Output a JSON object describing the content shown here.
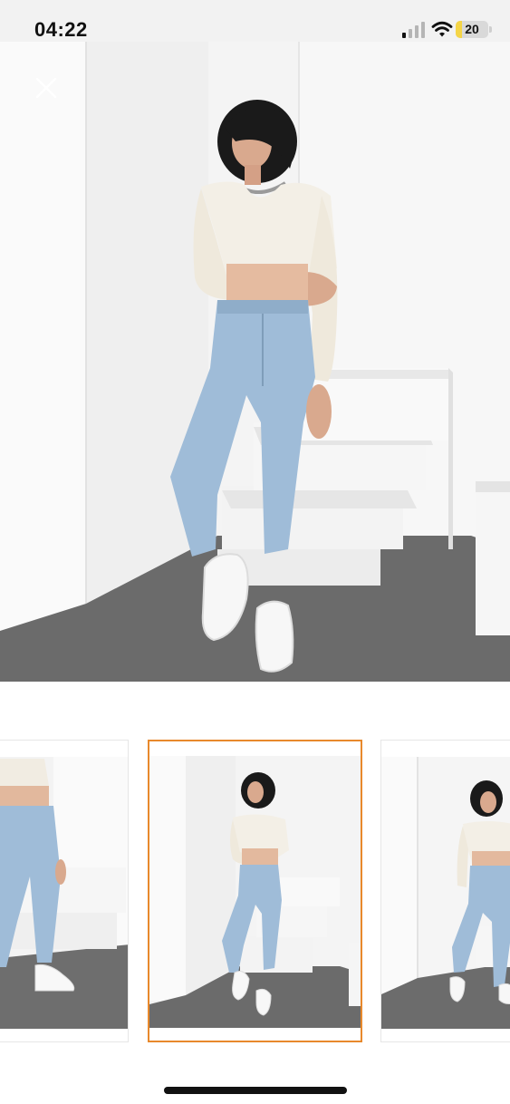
{
  "status_bar": {
    "time": "04:22",
    "battery_level": "20",
    "signal_icon": "cellular-signal-icon",
    "wifi_icon": "wifi-icon",
    "battery_icon": "battery-icon"
  },
  "viewer": {
    "close_icon": "close-icon",
    "thumbnail_count": 3,
    "selected_thumbnail": 2
  },
  "colors": {
    "selection_border": "#e8892c",
    "floor": "#6b6b6b",
    "denim": "#9fbcd8",
    "battery_fill": "#f5d547"
  }
}
